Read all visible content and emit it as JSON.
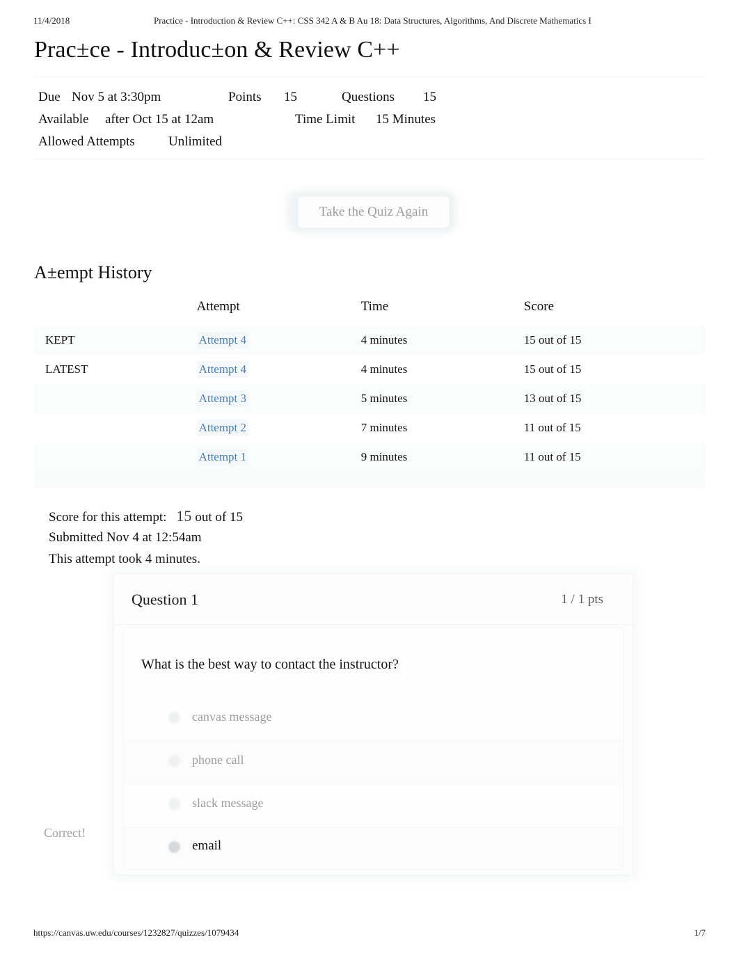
{
  "print_header": {
    "date": "11/4/2018",
    "title": "Practice - Introduction & Review C++: CSS 342 A & B Au 18: Data Structures, Algorithms, And Discrete Mathematics I"
  },
  "page_title": "Prac±ce - Introduc±on & Review C++",
  "quiz_meta": {
    "due_label": "Due",
    "due_value": "Nov 5 at 3:30pm",
    "points_label": "Points",
    "points_value": "15",
    "questions_label": "Questions",
    "questions_value": "15",
    "available_label": "Available",
    "available_value": "after Oct 15 at 12am",
    "time_limit_label": "Time Limit",
    "time_limit_value": "15 Minutes",
    "allowed_attempts_label": "Allowed Attempts",
    "allowed_attempts_value": "Unlimited"
  },
  "take_quiz_again_button": "Take the Quiz Again",
  "attempt_history": {
    "heading": "A±empt History",
    "columns": [
      "",
      "Attempt",
      "Time",
      "Score"
    ],
    "rows": [
      {
        "marker": "KEPT",
        "attempt": "Attempt 4",
        "time": "4 minutes",
        "score": "15 out of 15"
      },
      {
        "marker": "LATEST",
        "attempt": "Attempt 4",
        "time": "4 minutes",
        "score": "15 out of 15"
      },
      {
        "marker": "",
        "attempt": "Attempt 3",
        "time": "5 minutes",
        "score": "13 out of 15"
      },
      {
        "marker": "",
        "attempt": "Attempt 2",
        "time": "7 minutes",
        "score": "11 out of 15"
      },
      {
        "marker": "",
        "attempt": "Attempt 1",
        "time": "9 minutes",
        "score": "11 out of 15"
      }
    ]
  },
  "score_summary": {
    "score_label": "Score for this attempt:",
    "score_value": "15",
    "score_out_of": "out of 15",
    "submitted": "Submitted Nov 4 at 12:54am",
    "duration": "This attempt took 4 minutes."
  },
  "question": {
    "name": "Question 1",
    "points": "1 / 1 pts",
    "text": "What is the best way to contact the instructor?",
    "correct_flag": "Correct!",
    "answers": [
      {
        "label": "canvas message",
        "selected": false
      },
      {
        "label": "phone call",
        "selected": false
      },
      {
        "label": "slack message",
        "selected": false
      },
      {
        "label": "email",
        "selected": true
      }
    ]
  },
  "print_footer": {
    "url": "https://canvas.uw.edu/courses/1232827/quizzes/1079434",
    "page": "1/7"
  },
  "colors": {
    "link": "#4a7fb8",
    "text": "#111111",
    "muted": "#9ca0a3",
    "band": "#fbfcfc"
  }
}
